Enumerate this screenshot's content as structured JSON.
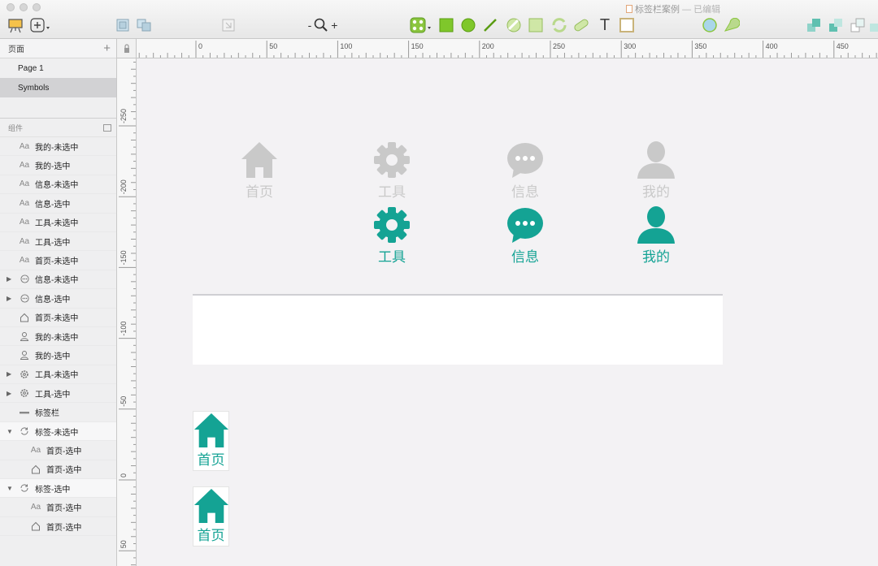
{
  "window": {
    "title": "标签栏案例",
    "title_status": "— 已编辑"
  },
  "colors": {
    "accent": "#14a394",
    "inactive": "#c9c9c9",
    "canvas": "#f3f2f4"
  },
  "toolbar": {
    "zoom_minus": "-",
    "zoom_plus": "+",
    "text_tool": "T"
  },
  "sidebar": {
    "pages_title": "页面",
    "pages": [
      {
        "label": "Page 1"
      },
      {
        "label": "Symbols"
      }
    ],
    "layers_title": "组件",
    "layers": [
      {
        "label": "我的-未选中",
        "icon": "text-icon"
      },
      {
        "label": "我的-选中",
        "icon": "text-icon"
      },
      {
        "label": "信息-未选中",
        "icon": "text-icon"
      },
      {
        "label": "信息-选中",
        "icon": "text-icon"
      },
      {
        "label": "工具-未选中",
        "icon": "text-icon"
      },
      {
        "label": "工具-选中",
        "icon": "text-icon"
      },
      {
        "label": "首页-未选中",
        "icon": "text-icon"
      },
      {
        "label": "信息-未选中",
        "icon": "chat-icon"
      },
      {
        "label": "信息-选中",
        "icon": "chat-icon"
      },
      {
        "label": "首页-未选中",
        "icon": "home-icon"
      },
      {
        "label": "我的-未选中",
        "icon": "person-icon"
      },
      {
        "label": "我的-选中",
        "icon": "person-icon"
      },
      {
        "label": "工具-未选中",
        "icon": "gear-icon"
      },
      {
        "label": "工具-选中",
        "icon": "gear-icon"
      },
      {
        "label": "标签栏",
        "icon": "line-icon"
      },
      {
        "label": "标签-未选中",
        "icon": "symbol-icon"
      },
      {
        "label": "首页-选中",
        "icon": "text-icon"
      },
      {
        "label": "首页-选中",
        "icon": "home-icon"
      },
      {
        "label": "标签-选中",
        "icon": "symbol-icon"
      },
      {
        "label": "首页-选中",
        "icon": "text-icon"
      },
      {
        "label": "首页-选中",
        "icon": "home-icon"
      }
    ],
    "text_glyph": "Aa"
  },
  "ruler": {
    "top_labels": [
      "0",
      "50",
      "100",
      "150",
      "200",
      "250",
      "300",
      "350",
      "400",
      "450"
    ],
    "left_labels": [
      "-250",
      "-200",
      "-150",
      "-100",
      "-50",
      "0",
      "50"
    ]
  },
  "canvas": {
    "tabs_unselected": [
      {
        "label": "首页",
        "icon": "home-icon"
      },
      {
        "label": "工具",
        "icon": "gear-icon"
      },
      {
        "label": "信息",
        "icon": "chat-icon"
      },
      {
        "label": "我的",
        "icon": "person-icon"
      }
    ],
    "tabs_selected": [
      {
        "label": "工具",
        "icon": "gear-icon"
      },
      {
        "label": "信息",
        "icon": "chat-icon"
      },
      {
        "label": "我的",
        "icon": "person-icon"
      }
    ],
    "symbols": [
      {
        "label": "首页",
        "icon": "home-icon"
      },
      {
        "label": "首页",
        "icon": "home-icon"
      }
    ]
  }
}
